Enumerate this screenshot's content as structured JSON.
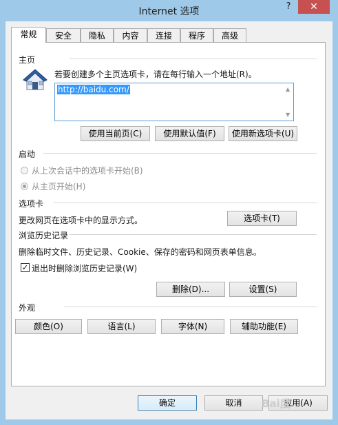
{
  "window": {
    "title": "Internet 选项",
    "help": "?",
    "close": "✕"
  },
  "tabs": [
    "常规",
    "安全",
    "隐私",
    "内容",
    "连接",
    "程序",
    "高级"
  ],
  "homepage": {
    "label": "主页",
    "instruction": "若要创建多个主页选项卡，请在每行输入一个地址(R)。",
    "url": "http://baidu.com/",
    "use_current": "使用当前页(C)",
    "use_default": "使用默认值(F)",
    "use_new_tab": "使用新选项卡(U)"
  },
  "startup": {
    "label": "启动",
    "option_last_session": "从上次会话中的选项卡开始(B)",
    "option_homepage": "从主页开始(H)"
  },
  "tabs_section": {
    "label": "选项卡",
    "description": "更改网页在选项卡中的显示方式。",
    "button": "选项卡(T)"
  },
  "history": {
    "label": "浏览历史记录",
    "description": "删除临时文件、历史记录、Cookie、保存的密码和网页表单信息。",
    "checkbox": "退出时删除浏览历史记录(W)",
    "delete": "删除(D)...",
    "settings": "设置(S)"
  },
  "appearance": {
    "label": "外观",
    "colors": "颜色(O)",
    "languages": "语言(L)",
    "fonts": "字体(N)",
    "accessibility": "辅助功能(E)"
  },
  "footer": {
    "ok": "确定",
    "cancel": "取消",
    "apply": "应用(A)"
  },
  "watermark": "Bai度"
}
